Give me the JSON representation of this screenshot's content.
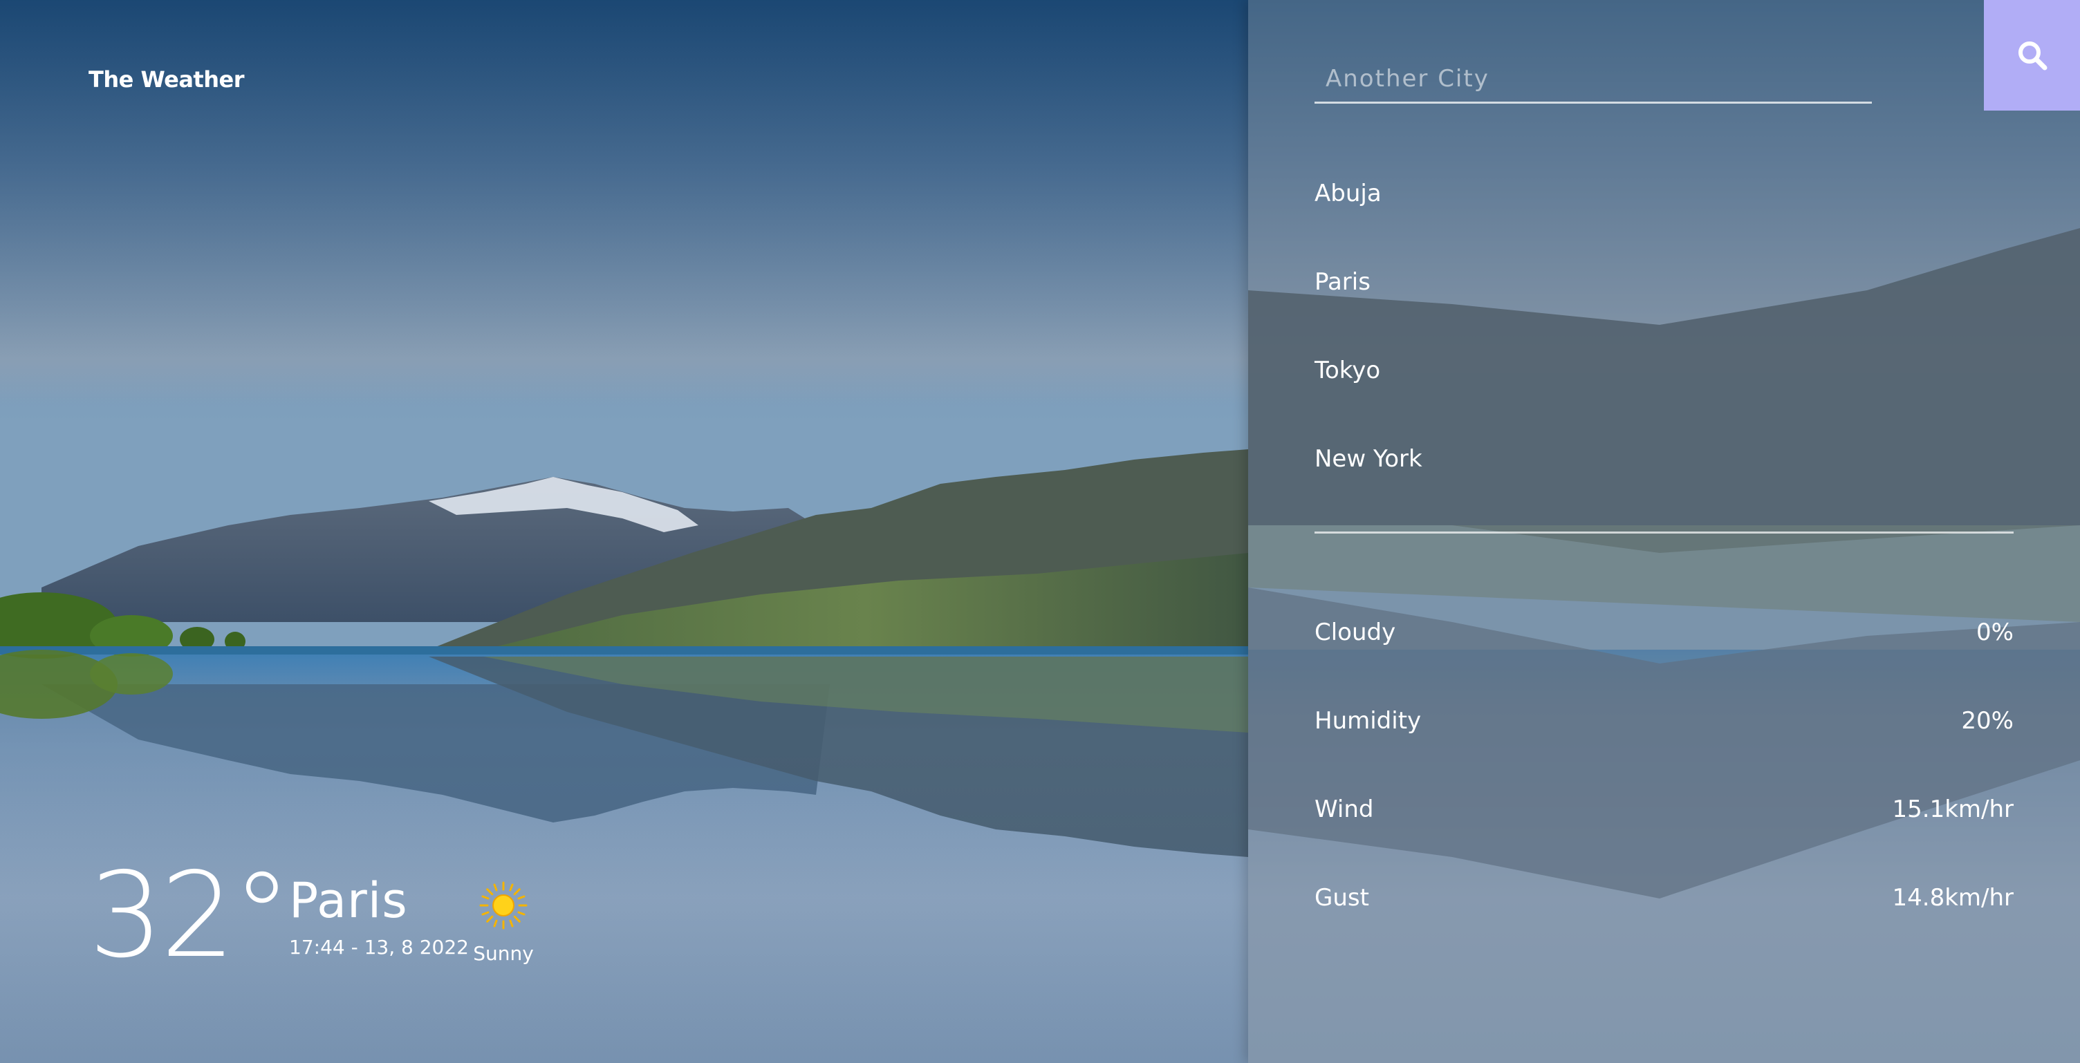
{
  "app": {
    "title": "The Weather"
  },
  "current": {
    "temperature": "32°",
    "city": "Paris",
    "datetime": "17:44 - 13, 8 2022",
    "condition": "Sunny",
    "condition_icon": "sun-icon"
  },
  "search": {
    "placeholder": "Another City",
    "value": "",
    "button_icon": "search-icon",
    "button_color": "#b1adf6"
  },
  "cities": [
    {
      "label": "Abuja"
    },
    {
      "label": "Paris"
    },
    {
      "label": "Tokyo"
    },
    {
      "label": "New York"
    }
  ],
  "details": [
    {
      "label": "Cloudy",
      "value": "0%"
    },
    {
      "label": "Humidity",
      "value": "20%"
    },
    {
      "label": "Wind",
      "value": "15.1km/hr"
    },
    {
      "label": "Gust",
      "value": "14.8km/hr"
    }
  ]
}
